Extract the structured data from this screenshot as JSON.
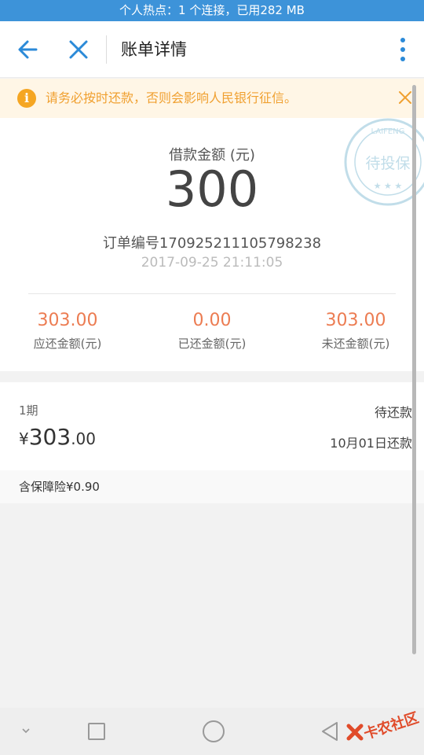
{
  "status_bar": {
    "text": "个人热点：1 个连接，已用282 MB"
  },
  "header": {
    "title": "账单详情"
  },
  "notice": {
    "text": "请务必按时还款，否则会影响人民银行征信。"
  },
  "loan": {
    "label": "借款金额 (元)",
    "amount": "300",
    "order_no": "订单编号170925211105798238",
    "timestamp": "2017-09-25 21:11:05"
  },
  "stamp": {
    "text": "待投保",
    "ring_text": "LAIFENG"
  },
  "stats": [
    {
      "value": "303.00",
      "label": "应还金额(元)"
    },
    {
      "value": "0.00",
      "label": "已还金额(元)"
    },
    {
      "value": "303.00",
      "label": "未还金额(元)"
    }
  ],
  "period": {
    "number": "1期",
    "status": "待还款",
    "currency": "¥",
    "amount_int": "303",
    "amount_dec": ".00",
    "due": "10月01日还款"
  },
  "insurance": {
    "text": "含保障险¥0.90"
  },
  "watermark": {
    "text": "卡农社区"
  },
  "colors": {
    "accent": "#3d93d9",
    "amount": "#ec7c52",
    "notice": "#f0a030"
  }
}
